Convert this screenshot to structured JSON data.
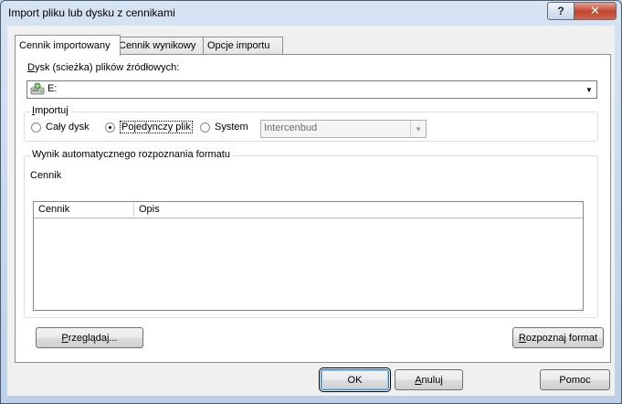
{
  "window": {
    "title": "Import pliku lub dysku z cennikami",
    "help_button": "?",
    "close_button": "✕"
  },
  "tabs": [
    {
      "label": "Cennik importowany",
      "active": true
    },
    {
      "label": "Cennik wynikowy",
      "active": false
    },
    {
      "label": "Opcje importu",
      "active": false
    }
  ],
  "source": {
    "label_access": "D",
    "label_rest": "ysk (scieżka) plików źródłowych:",
    "drive_value": "E:",
    "drive_icon": "drive-icon"
  },
  "import_group": {
    "title_access": "I",
    "title_rest": "mportuj",
    "options": [
      {
        "label": "Cały dysk",
        "selected": false
      },
      {
        "label": "Pojedynczy plik",
        "selected": true
      },
      {
        "label": "System",
        "selected": false
      }
    ],
    "system_value": "Intercenbud"
  },
  "result_group": {
    "title": "Wynik automatycznego rozpoznania formatu",
    "subtitle": "Cennik",
    "columns": [
      "Cennik",
      "Opis"
    ],
    "rows": []
  },
  "actions": {
    "browse_access": "P",
    "browse_rest": "rzeglądaj...",
    "detect_access": "R",
    "detect_rest": "ozpoznaj format"
  },
  "footer": {
    "ok": "OK",
    "cancel_access": "A",
    "cancel_rest": "nuluj",
    "help": "Pomoc"
  }
}
